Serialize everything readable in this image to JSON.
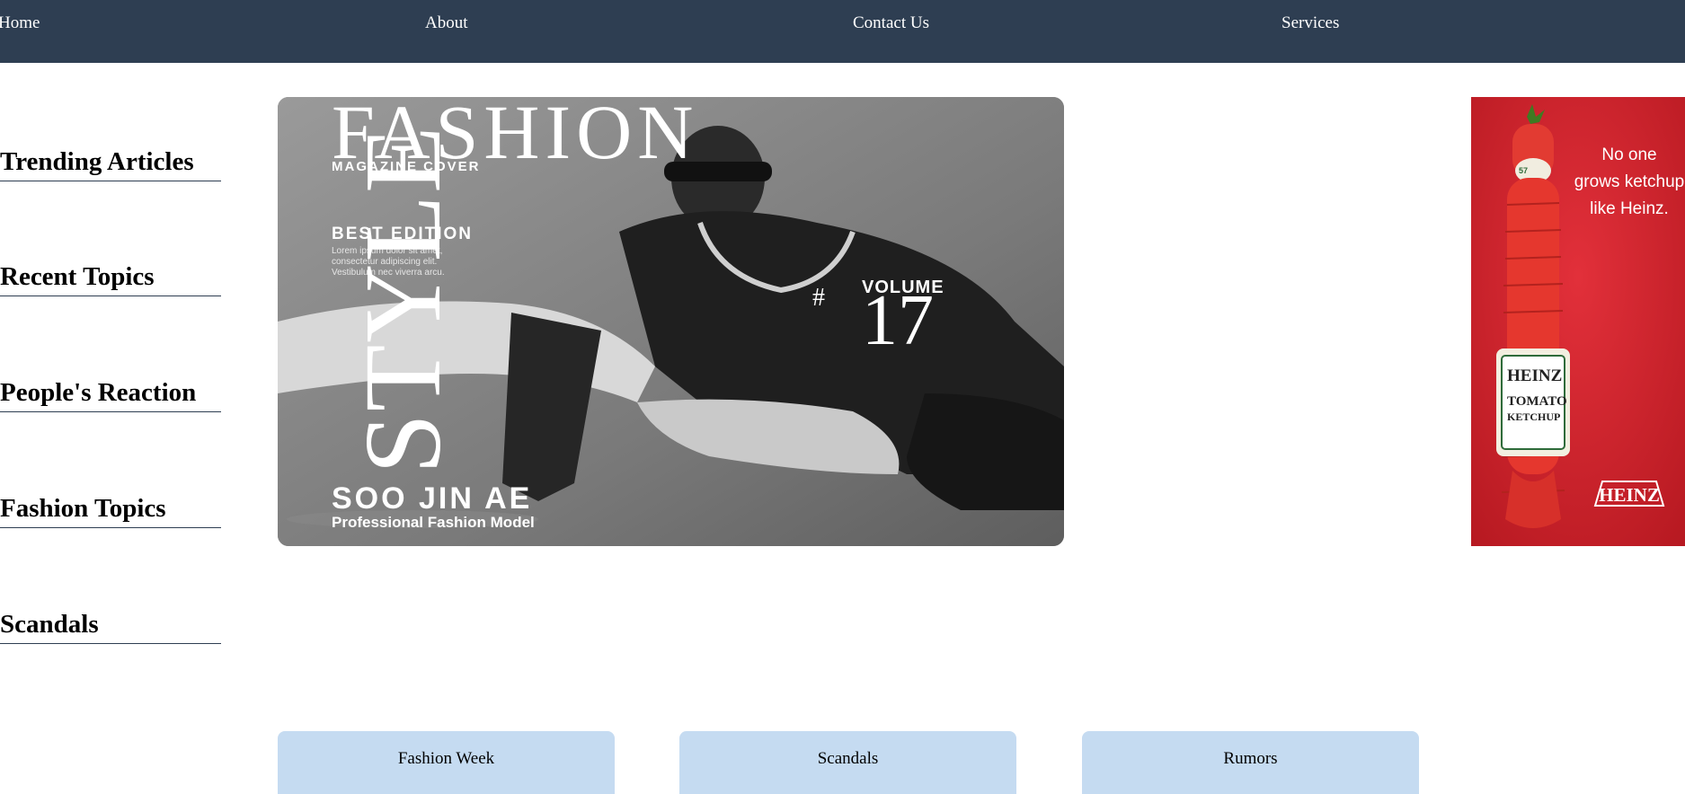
{
  "nav": {
    "home": "Home",
    "about": "About",
    "contact": "Contact Us",
    "services": "Services"
  },
  "sidebar": {
    "items": [
      {
        "label": "Trending Articles"
      },
      {
        "label": "Recent Topics"
      },
      {
        "label": "People's Reaction"
      },
      {
        "label": "Fashion Topics"
      },
      {
        "label": "Scandals"
      }
    ]
  },
  "hero": {
    "title": "FASHION",
    "subtitle": "MAGAZINE COVER",
    "edition": "BEST EDITION",
    "edition_text_1": "Lorem ipsum dolor sit amet,",
    "edition_text_2": "consectetur adipiscing elit.",
    "edition_text_3": "Vestibulum nec viverra arcu.",
    "vertical_word": "STYLE",
    "volume_label": "VOLUME",
    "volume_hash": "#",
    "volume_number": "17",
    "model_name": "SOO JIN AE",
    "model_role": "Professional Fashion Model"
  },
  "ad": {
    "line1": "No one",
    "line2": "grows ketchup",
    "line3": "like Heinz.",
    "label_brand": "HEINZ",
    "label_product_1": "TOMATO",
    "label_product_2": "KETCHUP",
    "label_cap": "57",
    "logo": "HEINZ"
  },
  "cards": [
    {
      "label": "Fashion Week"
    },
    {
      "label": "Scandals"
    },
    {
      "label": "Rumors"
    }
  ],
  "colors": {
    "nav_bg": "#2e3e52",
    "card_bg": "#c5dbf1",
    "ad_red": "#c8202a"
  }
}
